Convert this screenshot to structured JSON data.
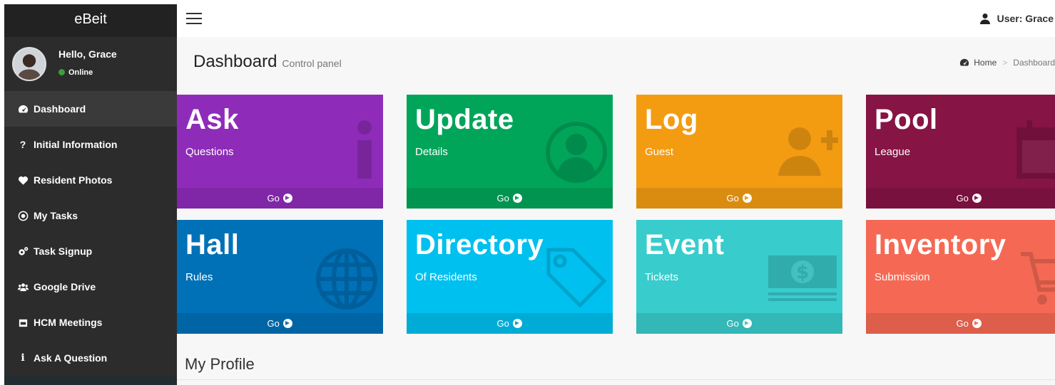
{
  "app": {
    "brand": "eBeit"
  },
  "user_panel": {
    "greeting": "Hello, Grace",
    "status": "Online",
    "status_color": "#3c9e3c"
  },
  "sidebar": {
    "items": [
      {
        "label": "Dashboard",
        "icon": "dashboard-icon"
      },
      {
        "label": "Initial Information",
        "icon": "question-icon"
      },
      {
        "label": "Resident Photos",
        "icon": "heart-icon"
      },
      {
        "label": "My Tasks",
        "icon": "dot-circle-icon"
      },
      {
        "label": "Task Signup",
        "icon": "gears-icon"
      },
      {
        "label": "Google Drive",
        "icon": "users-icon"
      },
      {
        "label": "HCM Meetings",
        "icon": "calendar-icon"
      },
      {
        "label": "Ask A Question",
        "icon": "info-icon"
      }
    ]
  },
  "navbar": {
    "user_label": "User: Grace"
  },
  "header": {
    "title": "Dashboard",
    "subtitle": "Control panel",
    "breadcrumb": {
      "home": "Home",
      "current": "Dashboard"
    }
  },
  "tiles": [
    {
      "title": "Ask",
      "subtitle": "Questions",
      "footer": "Go",
      "color": "#8e2cb9",
      "icon": "info-icon"
    },
    {
      "title": "Update",
      "subtitle": "Details",
      "footer": "Go",
      "color": "#00a55a",
      "icon": "user-circle-icon"
    },
    {
      "title": "Log",
      "subtitle": "Guest",
      "footer": "Go",
      "color": "#f39c12",
      "icon": "user-plus-icon"
    },
    {
      "title": "Pool",
      "subtitle": "League",
      "footer": "Go",
      "color": "#861445",
      "icon": "calendar-icon"
    },
    {
      "title": "Hall",
      "subtitle": "Rules",
      "footer": "Go",
      "color": "#0071b7",
      "icon": "globe-icon"
    },
    {
      "title": "Directory",
      "subtitle": "Of Residents",
      "footer": "Go",
      "color": "#00c0ef",
      "icon": "tag-icon"
    },
    {
      "title": "Event",
      "subtitle": "Tickets",
      "footer": "Go",
      "color": "#39cccc",
      "icon": "money-icon"
    },
    {
      "title": "Inventory",
      "subtitle": "Submission",
      "footer": "Go",
      "color": "#f56954",
      "icon": "cart-icon"
    }
  ],
  "profile": {
    "heading": "My Profile"
  }
}
